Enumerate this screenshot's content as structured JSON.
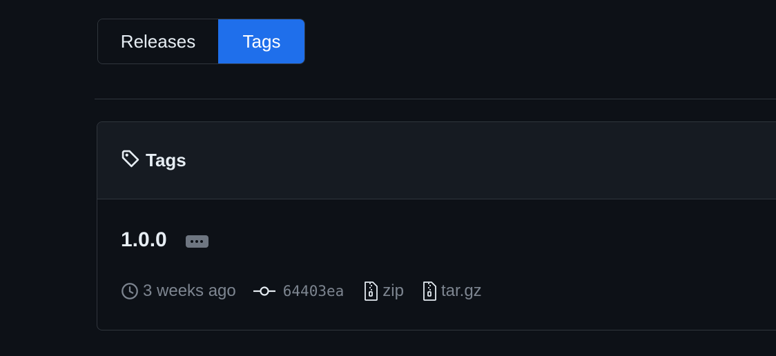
{
  "tabs": {
    "releases_label": "Releases",
    "tags_label": "Tags",
    "active": "Tags"
  },
  "box": {
    "title": "Tags",
    "title_icon": "tag-icon"
  },
  "tag": {
    "name": "1.0.0",
    "time": "3 weeks ago",
    "commit": "64403ea",
    "zip_label": "zip",
    "targz_label": "tar.gz"
  },
  "icons": {
    "time": "clock-icon",
    "commit": "git-commit-icon",
    "zip": "file-zip-icon",
    "targz": "file-zip-icon",
    "more": "kebab-horizontal-icon"
  },
  "colors": {
    "background": "#0d1117",
    "header_background": "#161b22",
    "border": "#30363d",
    "accent": "#1f6feb",
    "muted_text": "#7d8590",
    "text": "#e6edf3"
  }
}
